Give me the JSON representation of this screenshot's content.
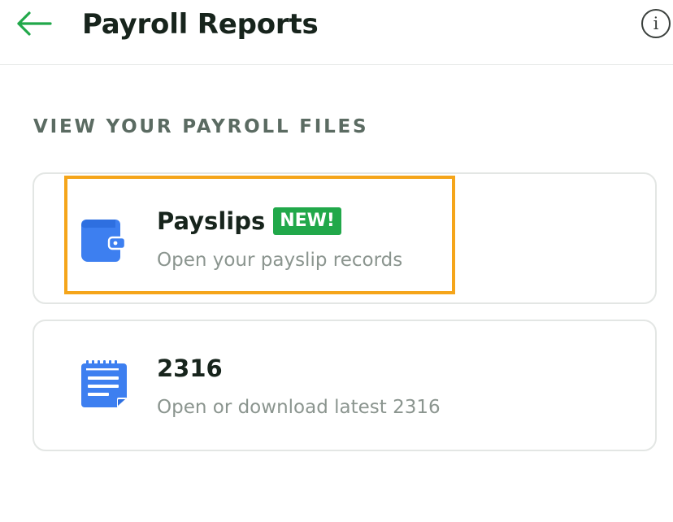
{
  "header": {
    "title": "Payroll Reports",
    "back_icon": "arrow-left-icon",
    "info_icon": "info-icon",
    "info_glyph": "i"
  },
  "section": {
    "heading": "VIEW YOUR PAYROLL FILES"
  },
  "cards": [
    {
      "icon": "wallet-icon",
      "title": "Payslips",
      "badge": "NEW!",
      "subtitle": "Open your payslip records"
    },
    {
      "icon": "document-icon",
      "title": "2316",
      "subtitle": "Open or download latest 2316"
    }
  ],
  "colors": {
    "accent_green": "#21a84a",
    "icon_blue": "#3d7ff0",
    "highlight": "#f5a51a",
    "title_text": "#17241c",
    "muted_text": "#8b958f"
  }
}
